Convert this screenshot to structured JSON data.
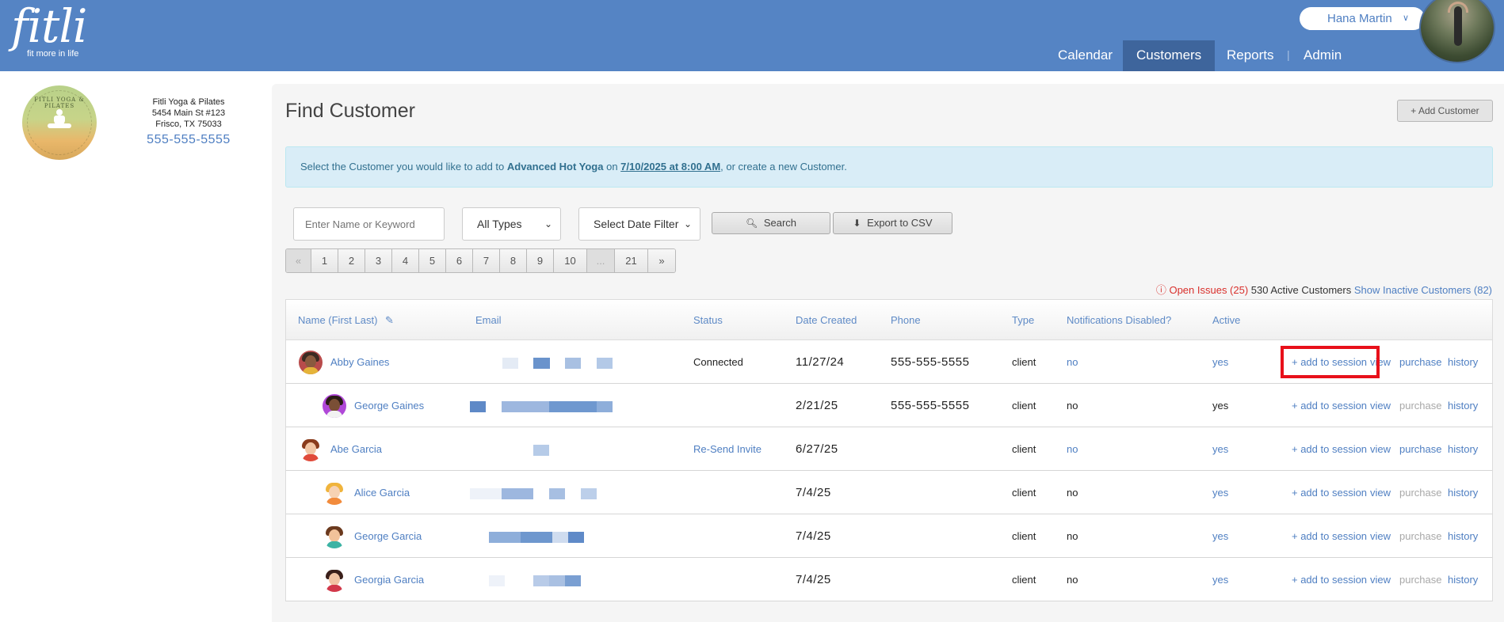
{
  "header": {
    "logo_word": "fitli",
    "logo_tagline": "fit more in life",
    "user_name": "Hana Martin",
    "nav": [
      "Calendar",
      "Customers",
      "Reports",
      "Admin"
    ],
    "active_nav": "Customers"
  },
  "studio": {
    "logo_text": "FITLI YOGA & PILATES",
    "name": "Fitli Yoga & Pilates",
    "address1": "5454 Main St #123",
    "address2": "Frisco, TX 75033",
    "phone": "555-555-5555"
  },
  "page": {
    "title": "Find Customer",
    "add_button": "+ Add Customer"
  },
  "notice": {
    "prefix": "Select the Customer you would like to add to ",
    "class_name": "Advanced Hot Yoga",
    "mid": " on ",
    "datetime": "7/10/2025 at 8:00 AM",
    "suffix": ", or create a new Customer."
  },
  "filters": {
    "search_placeholder": "Enter Name or Keyword",
    "type_select": "All Types",
    "date_select": "Select Date Filter",
    "search_button": "Search",
    "export_button": "Export to CSV"
  },
  "pager": [
    "«",
    "1",
    "2",
    "3",
    "4",
    "5",
    "6",
    "7",
    "8",
    "9",
    "10",
    "...",
    "21",
    "»"
  ],
  "counts": {
    "issues": "Open Issues (25)",
    "active": "530 Active Customers",
    "inactive": "Show Inactive Customers (82)"
  },
  "table": {
    "headers": [
      "Name (First Last)",
      "Email",
      "Status",
      "Date Created",
      "Phone",
      "Type",
      "Notifications Disabled?",
      "Active"
    ],
    "rows": [
      {
        "name": "Abby Gaines",
        "status": "Connected",
        "date": "11/27/24",
        "phone": "555-555-5555",
        "type": "client",
        "notif": "no",
        "active": "yes",
        "add": "+ add to session",
        "view": "view",
        "purchase": "purchase",
        "history": "history"
      },
      {
        "name": "George Gaines",
        "status": "",
        "date": "2/21/25",
        "phone": "555-555-5555",
        "type": "client",
        "notif": "no",
        "active": "yes",
        "add": "+ add to session",
        "view": "view",
        "purchase": "purchase",
        "history": "history"
      },
      {
        "name": "Abe Garcia",
        "status": "Re-Send Invite",
        "date": "6/27/25",
        "phone": "",
        "type": "client",
        "notif": "no",
        "active": "yes",
        "add": "+ add to session",
        "view": "view",
        "purchase": "purchase",
        "history": "history"
      },
      {
        "name": "Alice Garcia",
        "status": "",
        "date": "7/4/25",
        "phone": "",
        "type": "client",
        "notif": "no",
        "active": "yes",
        "add": "+ add to session",
        "view": "view",
        "purchase": "purchase",
        "history": "history"
      },
      {
        "name": "George Garcia",
        "status": "",
        "date": "7/4/25",
        "phone": "",
        "type": "client",
        "notif": "no",
        "active": "yes",
        "add": "+ add to session",
        "view": "view",
        "purchase": "purchase",
        "history": "history"
      },
      {
        "name": "Georgia Garcia",
        "status": "",
        "date": "7/4/25",
        "phone": "",
        "type": "client",
        "notif": "no",
        "active": "yes",
        "add": "+ add to session",
        "view": "view",
        "purchase": "purchase",
        "history": "history"
      }
    ]
  },
  "colors": {
    "header_bg": "#5584c4",
    "nav_active_bg": "#3e659c",
    "link_blue": "#4f7fc2",
    "notice_bg": "#d9edf7",
    "highlight_red": "#e8101a"
  }
}
